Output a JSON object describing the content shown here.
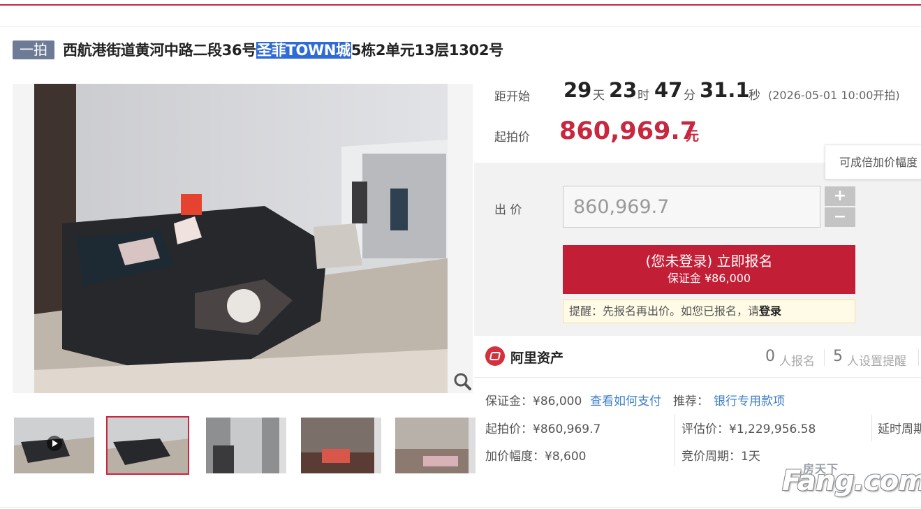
{
  "auction": {
    "badge": "一拍",
    "title_before": "西航港街道黄河中路二段36号",
    "title_highlight": "圣菲TOWN城",
    "title_after": "5栋2单元13层1302号"
  },
  "countdown": {
    "label": "距开始",
    "days": "29",
    "days_unit": "天",
    "hours": "23",
    "hours_unit": "时",
    "minutes": "47",
    "minutes_unit": "分",
    "seconds": "31.1",
    "seconds_unit": "秒",
    "start_note": "(2026-05-01 10:00开拍)"
  },
  "starting_price": {
    "label": "起拍价",
    "value": "860,969.7",
    "unit": "元"
  },
  "bid": {
    "label": "出 价",
    "input_value": "860,969.7",
    "plus": "+",
    "minus": "−",
    "tooltip": "可成倍加价幅度"
  },
  "signup": {
    "main_label": "(您未登录) 立即报名",
    "deposit_label": "保证金 ¥86,000"
  },
  "notice": {
    "text": "提醒：先报名再出价。如您已报名，请",
    "login": "登录"
  },
  "platform": {
    "name": "阿里资产",
    "signups_count": "0",
    "signups_label": "人报名",
    "reminders_count": "5",
    "reminders_label": "人设置提醒"
  },
  "details": {
    "deposit": "保证金：¥86,000",
    "pay_link": "查看如何支付",
    "recommend_label": "推荐：",
    "recommend_link": "银行专用款项",
    "start_price": "起拍价：¥860,969.7",
    "appraisal": "评估价：¥1,229,956.58",
    "delay": "延时周期",
    "increment": "加价幅度：¥8,600",
    "cycle": "竞价周期：1天"
  },
  "watermark": {
    "cn": "房天下",
    "en": "Fang.com"
  },
  "icons": {
    "zoom": "magnifier-icon",
    "play": "play-icon",
    "logo": "ali-asset-logo-icon"
  },
  "colors": {
    "accent": "#c8273f",
    "link": "#3c7ec6",
    "badge": "#6d7b96"
  }
}
